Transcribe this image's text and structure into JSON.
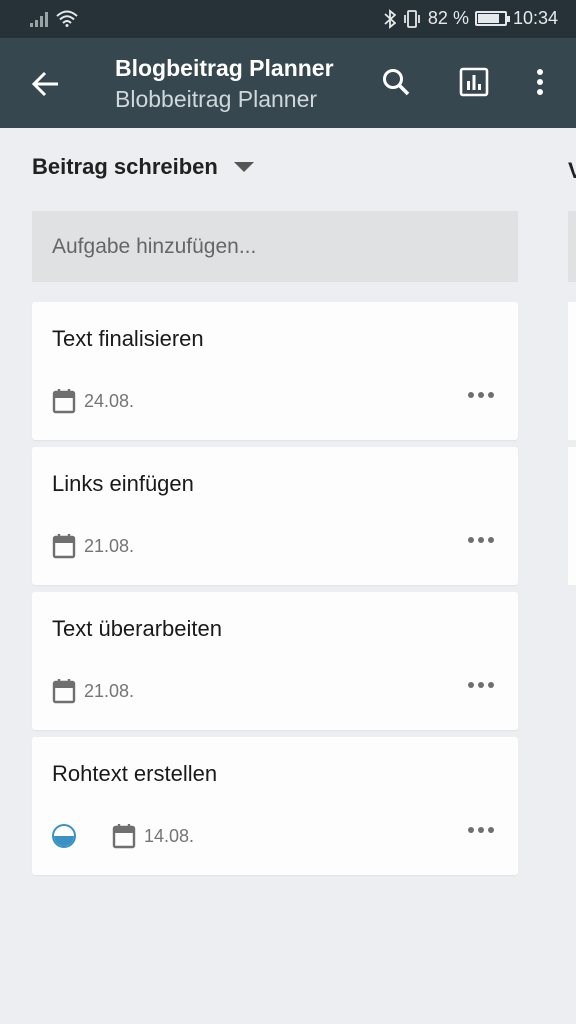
{
  "status": {
    "battery": "82 %",
    "time": "10:34",
    "battery_level": 0.82
  },
  "appbar": {
    "title": "Blogbeitrag Planner",
    "subtitle": "Blobbeitrag Planner",
    "icons": [
      "back-arrow-icon",
      "search-icon",
      "chart-icon",
      "more-vert-icon"
    ]
  },
  "column": {
    "title": "Beitrag schreiben",
    "next_title": "V",
    "add_placeholder": "Aufgabe hinzufügen..."
  },
  "cards": [
    {
      "title": "Text finalisieren",
      "date": "24.08."
    },
    {
      "title": "Links einfügen",
      "date": "21.08."
    },
    {
      "title": "Text überarbeiten",
      "date": "21.08."
    },
    {
      "title": "Rohtext erstellen",
      "date": "14.08.",
      "progress": 0.5
    }
  ],
  "colors": {
    "appbar": "#37474f",
    "statusbar": "#263238",
    "accent": "#3a91c4",
    "background": "#eceef1"
  }
}
